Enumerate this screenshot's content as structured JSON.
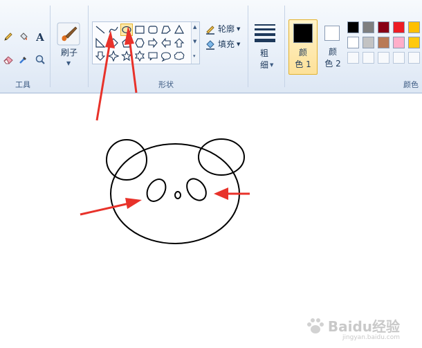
{
  "ribbon": {
    "tools_group": {
      "label": "工具"
    },
    "brush": {
      "label": "刷子"
    },
    "shapes_group": {
      "label": "形状",
      "outline_label": "轮廓",
      "fill_label": "填充",
      "selected_shape": "ellipse"
    },
    "size": {
      "label_line1": "粗",
      "label_line2": "细"
    },
    "color1": {
      "label_line1": "颜",
      "label_line2": "色 1",
      "color": "#000000"
    },
    "color2": {
      "label_line1": "颜",
      "label_line2": "色 2",
      "color": "#ffffff"
    },
    "colors_group": {
      "label": "颜色",
      "palette_row1": [
        "#000000",
        "#7f7f7f",
        "#880015",
        "#ed1c24",
        "#ffc000"
      ],
      "palette_row2": [
        "#ffffff",
        "#c3c3c3",
        "#b97a57",
        "#ffaec9",
        "#ffc90e"
      ]
    }
  },
  "annotations": {
    "arrow_color": "#e8322a"
  },
  "watermark": {
    "brand": "Baidu经验",
    "url": "jingyan.baidu.com"
  }
}
